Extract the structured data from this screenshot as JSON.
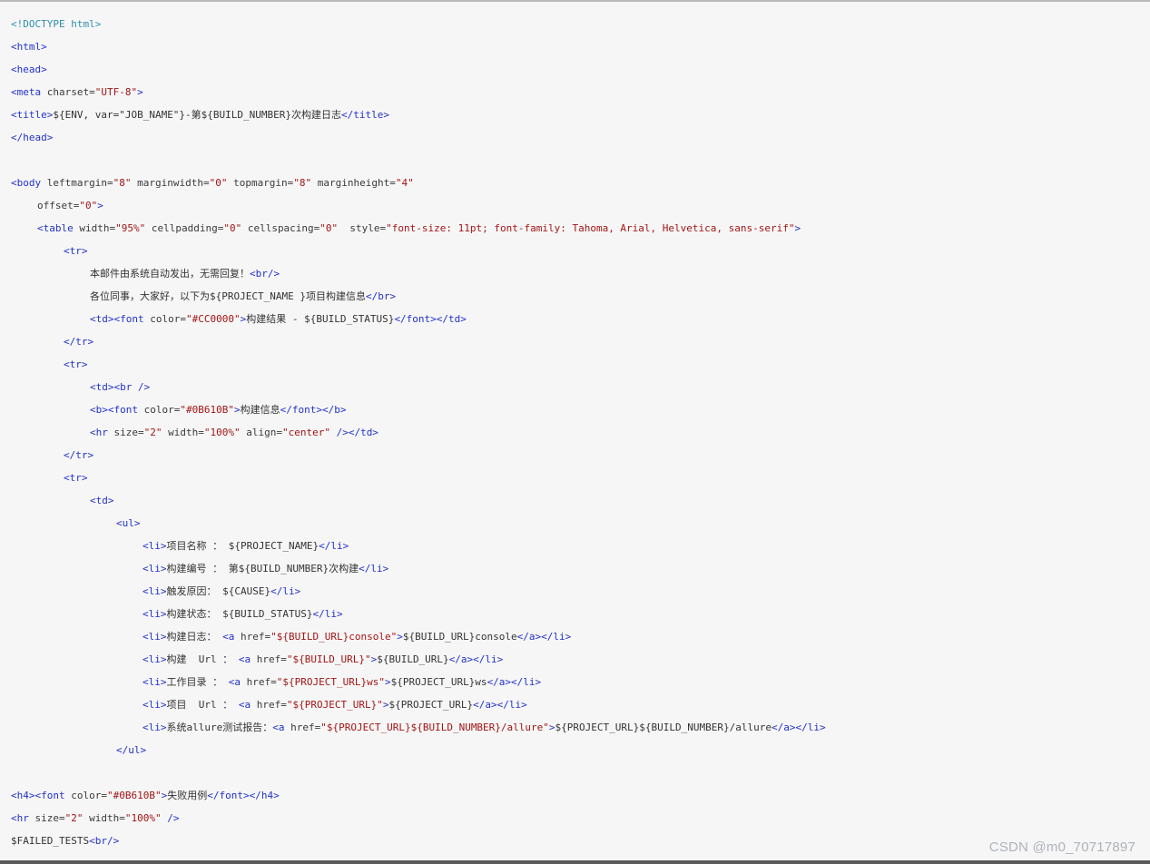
{
  "code": {
    "lines": [
      {
        "indent": 0,
        "tokens": [
          {
            "t": "dec",
            "v": "<!DOCTYPE html>"
          }
        ]
      },
      {
        "indent": 0,
        "tokens": [
          {
            "t": "tag",
            "v": "<html>"
          }
        ]
      },
      {
        "indent": 0,
        "tokens": [
          {
            "t": "tag",
            "v": "<head>"
          }
        ]
      },
      {
        "indent": 0,
        "tokens": [
          {
            "t": "tag",
            "v": "<meta "
          },
          {
            "t": "attr",
            "v": "charset="
          },
          {
            "t": "str",
            "v": "\"UTF-8\""
          },
          {
            "t": "tag",
            "v": ">"
          }
        ]
      },
      {
        "indent": 0,
        "tokens": [
          {
            "t": "tag",
            "v": "<title>"
          },
          {
            "t": "txt",
            "v": "${ENV, var=\"JOB_NAME\"}-第${BUILD_NUMBER}次构建日志"
          },
          {
            "t": "tag",
            "v": "</title>"
          }
        ]
      },
      {
        "indent": 0,
        "tokens": [
          {
            "t": "tag",
            "v": "</head>"
          }
        ]
      },
      {
        "indent": 0,
        "tokens": []
      },
      {
        "indent": 0,
        "tokens": [
          {
            "t": "tag",
            "v": "<body "
          },
          {
            "t": "attr",
            "v": "leftmargin="
          },
          {
            "t": "str",
            "v": "\"8\""
          },
          {
            "t": "attr",
            "v": " marginwidth="
          },
          {
            "t": "str",
            "v": "\"0\""
          },
          {
            "t": "attr",
            "v": " topmargin="
          },
          {
            "t": "str",
            "v": "\"8\""
          },
          {
            "t": "attr",
            "v": " marginheight="
          },
          {
            "t": "str",
            "v": "\"4\""
          }
        ]
      },
      {
        "indent": 1,
        "tokens": [
          {
            "t": "attr",
            "v": "offset="
          },
          {
            "t": "str",
            "v": "\"0\""
          },
          {
            "t": "tag",
            "v": ">"
          }
        ]
      },
      {
        "indent": 1,
        "tokens": [
          {
            "t": "tag",
            "v": "<table "
          },
          {
            "t": "attr",
            "v": "width="
          },
          {
            "t": "str",
            "v": "\"95%\""
          },
          {
            "t": "attr",
            "v": " cellpadding="
          },
          {
            "t": "str",
            "v": "\"0\""
          },
          {
            "t": "attr",
            "v": " cellspacing="
          },
          {
            "t": "str",
            "v": "\"0\""
          },
          {
            "t": "attr",
            "v": "  style="
          },
          {
            "t": "str",
            "v": "\"font-size: 11pt; font-family: Tahoma, Arial, Helvetica, sans-serif\""
          },
          {
            "t": "tag",
            "v": ">"
          }
        ]
      },
      {
        "indent": 2,
        "tokens": [
          {
            "t": "tag",
            "v": "<tr>"
          }
        ]
      },
      {
        "indent": 3,
        "tokens": [
          {
            "t": "txt",
            "v": "本邮件由系统自动发出，无需回复！"
          },
          {
            "t": "tag",
            "v": "<br/>"
          }
        ]
      },
      {
        "indent": 3,
        "tokens": [
          {
            "t": "txt",
            "v": "各位同事，大家好，以下为${PROJECT_NAME }项目构建信息"
          },
          {
            "t": "tag",
            "v": "</br>"
          }
        ]
      },
      {
        "indent": 3,
        "tokens": [
          {
            "t": "tag",
            "v": "<td><font "
          },
          {
            "t": "attr",
            "v": "color="
          },
          {
            "t": "str",
            "v": "\"#CC0000\""
          },
          {
            "t": "tag",
            "v": ">"
          },
          {
            "t": "txt",
            "v": "构建结果 - ${BUILD_STATUS}"
          },
          {
            "t": "tag",
            "v": "</font></td>"
          }
        ]
      },
      {
        "indent": 2,
        "tokens": [
          {
            "t": "tag",
            "v": "</tr>"
          }
        ]
      },
      {
        "indent": 2,
        "tokens": [
          {
            "t": "tag",
            "v": "<tr>"
          }
        ]
      },
      {
        "indent": 3,
        "tokens": [
          {
            "t": "tag",
            "v": "<td><br />"
          }
        ]
      },
      {
        "indent": 3,
        "tokens": [
          {
            "t": "tag",
            "v": "<b><font "
          },
          {
            "t": "attr",
            "v": "color="
          },
          {
            "t": "str",
            "v": "\"#0B610B\""
          },
          {
            "t": "tag",
            "v": ">"
          },
          {
            "t": "txt",
            "v": "构建信息"
          },
          {
            "t": "tag",
            "v": "</font></b>"
          }
        ]
      },
      {
        "indent": 3,
        "tokens": [
          {
            "t": "tag",
            "v": "<hr "
          },
          {
            "t": "attr",
            "v": "size="
          },
          {
            "t": "str",
            "v": "\"2\""
          },
          {
            "t": "attr",
            "v": " width="
          },
          {
            "t": "str",
            "v": "\"100%\""
          },
          {
            "t": "attr",
            "v": " align="
          },
          {
            "t": "str",
            "v": "\"center\""
          },
          {
            "t": "tag",
            "v": " /></td>"
          }
        ]
      },
      {
        "indent": 2,
        "tokens": [
          {
            "t": "tag",
            "v": "</tr>"
          }
        ]
      },
      {
        "indent": 2,
        "tokens": [
          {
            "t": "tag",
            "v": "<tr>"
          }
        ]
      },
      {
        "indent": 3,
        "tokens": [
          {
            "t": "tag",
            "v": "<td>"
          }
        ]
      },
      {
        "indent": 4,
        "tokens": [
          {
            "t": "tag",
            "v": "<ul>"
          }
        ]
      },
      {
        "indent": 5,
        "tokens": [
          {
            "t": "tag",
            "v": "<li>"
          },
          {
            "t": "txt",
            "v": "项目名称 ： ${PROJECT_NAME}"
          },
          {
            "t": "tag",
            "v": "</li>"
          }
        ]
      },
      {
        "indent": 5,
        "tokens": [
          {
            "t": "tag",
            "v": "<li>"
          },
          {
            "t": "txt",
            "v": "构建编号 ： 第${BUILD_NUMBER}次构建"
          },
          {
            "t": "tag",
            "v": "</li>"
          }
        ]
      },
      {
        "indent": 5,
        "tokens": [
          {
            "t": "tag",
            "v": "<li>"
          },
          {
            "t": "txt",
            "v": "触发原因： ${CAUSE}"
          },
          {
            "t": "tag",
            "v": "</li>"
          }
        ]
      },
      {
        "indent": 5,
        "tokens": [
          {
            "t": "tag",
            "v": "<li>"
          },
          {
            "t": "txt",
            "v": "构建状态： ${BUILD_STATUS}"
          },
          {
            "t": "tag",
            "v": "</li>"
          }
        ]
      },
      {
        "indent": 5,
        "tokens": [
          {
            "t": "tag",
            "v": "<li>"
          },
          {
            "t": "txt",
            "v": "构建日志： "
          },
          {
            "t": "tag",
            "v": "<a "
          },
          {
            "t": "attr",
            "v": "href="
          },
          {
            "t": "str",
            "v": "\"${BUILD_URL}console\""
          },
          {
            "t": "tag",
            "v": ">"
          },
          {
            "t": "txt",
            "v": "${BUILD_URL}console"
          },
          {
            "t": "tag",
            "v": "</a></li>"
          }
        ]
      },
      {
        "indent": 5,
        "tokens": [
          {
            "t": "tag",
            "v": "<li>"
          },
          {
            "t": "txt",
            "v": "构建  Url ： "
          },
          {
            "t": "tag",
            "v": "<a "
          },
          {
            "t": "attr",
            "v": "href="
          },
          {
            "t": "str",
            "v": "\"${BUILD_URL}\""
          },
          {
            "t": "tag",
            "v": ">"
          },
          {
            "t": "txt",
            "v": "${BUILD_URL}"
          },
          {
            "t": "tag",
            "v": "</a></li>"
          }
        ]
      },
      {
        "indent": 5,
        "tokens": [
          {
            "t": "tag",
            "v": "<li>"
          },
          {
            "t": "txt",
            "v": "工作目录 ： "
          },
          {
            "t": "tag",
            "v": "<a "
          },
          {
            "t": "attr",
            "v": "href="
          },
          {
            "t": "str",
            "v": "\"${PROJECT_URL}ws\""
          },
          {
            "t": "tag",
            "v": ">"
          },
          {
            "t": "txt",
            "v": "${PROJECT_URL}ws"
          },
          {
            "t": "tag",
            "v": "</a></li>"
          }
        ]
      },
      {
        "indent": 5,
        "tokens": [
          {
            "t": "tag",
            "v": "<li>"
          },
          {
            "t": "txt",
            "v": "项目  Url ： "
          },
          {
            "t": "tag",
            "v": "<a "
          },
          {
            "t": "attr",
            "v": "href="
          },
          {
            "t": "str",
            "v": "\"${PROJECT_URL}\""
          },
          {
            "t": "tag",
            "v": ">"
          },
          {
            "t": "txt",
            "v": "${PROJECT_URL}"
          },
          {
            "t": "tag",
            "v": "</a></li>"
          }
        ]
      },
      {
        "indent": 5,
        "tokens": [
          {
            "t": "tag",
            "v": "<li>"
          },
          {
            "t": "txt",
            "v": "系统allure测试报告："
          },
          {
            "t": "tag",
            "v": "<a "
          },
          {
            "t": "attr",
            "v": "href="
          },
          {
            "t": "str",
            "v": "\"${PROJECT_URL}${BUILD_NUMBER}/allure\""
          },
          {
            "t": "tag",
            "v": ">"
          },
          {
            "t": "txt",
            "v": "${PROJECT_URL}${BUILD_NUMBER}/allure"
          },
          {
            "t": "tag",
            "v": "</a></li>"
          }
        ]
      },
      {
        "indent": 4,
        "tokens": [
          {
            "t": "tag",
            "v": "</ul>"
          }
        ]
      },
      {
        "indent": 0,
        "tokens": []
      },
      {
        "indent": 0,
        "tokens": [
          {
            "t": "tag",
            "v": "<h4><font "
          },
          {
            "t": "attr",
            "v": "color="
          },
          {
            "t": "str",
            "v": "\"#0B610B\""
          },
          {
            "t": "tag",
            "v": ">"
          },
          {
            "t": "txt",
            "v": "失败用例"
          },
          {
            "t": "tag",
            "v": "</font></h4>"
          }
        ]
      },
      {
        "indent": 0,
        "tokens": [
          {
            "t": "tag",
            "v": "<hr "
          },
          {
            "t": "attr",
            "v": "size="
          },
          {
            "t": "str",
            "v": "\"2\""
          },
          {
            "t": "attr",
            "v": " width="
          },
          {
            "t": "str",
            "v": "\"100%\""
          },
          {
            "t": "tag",
            "v": " />"
          }
        ]
      },
      {
        "indent": 0,
        "tokens": [
          {
            "t": "txt",
            "v": "$FAILED_TESTS"
          },
          {
            "t": "tag",
            "v": "<br/>"
          }
        ]
      }
    ]
  },
  "watermark": {
    "text": "CSDN @m0_70717897"
  },
  "colors": {
    "tag": "#2232cc",
    "string": "#a31515",
    "doctype": "#2f8fb0",
    "background": "#f6f6f6"
  }
}
